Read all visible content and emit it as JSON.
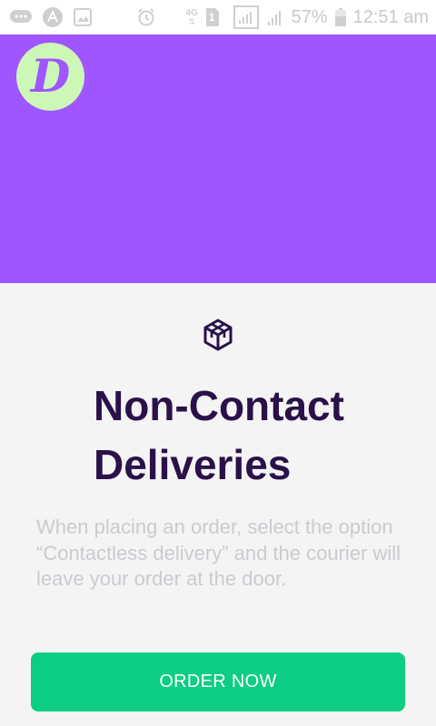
{
  "colors": {
    "hero_bg": "#9f55ff",
    "logo_bg": "#ccf7b7",
    "title": "#2a1149",
    "body_text": "#cdc9d1",
    "button": "#0bce83",
    "page_bg": "#f4f4f4"
  },
  "statusbar": {
    "left_icons": [
      "chat-icon",
      "a-notification-icon",
      "image-icon",
      "alarm-icon"
    ],
    "network": "4G",
    "sim": "1",
    "battery_percent": "57%",
    "time": "12:51 am"
  },
  "hero": {
    "logo_letter": "D",
    "logo_icon": "app-logo"
  },
  "content": {
    "icon": "cube-icon",
    "title": "Non-Contact Deliveries",
    "description": "When placing an order, select the option “Contactless delivery” and the courier will leave your order at the door.",
    "button_label": "ORDER NOW"
  }
}
